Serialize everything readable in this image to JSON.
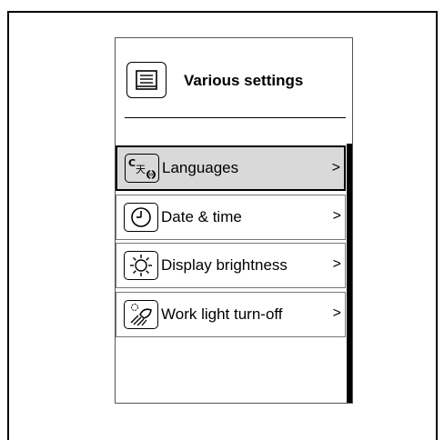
{
  "header": {
    "title": "Various settings",
    "icon": "document-icon"
  },
  "menu": {
    "items": [
      {
        "label": "Languages",
        "arrow": ">",
        "icon": "language-icon",
        "icon_glyph": "C天Φ",
        "selected": true
      },
      {
        "label": "Date & time",
        "arrow": ">",
        "icon": "clock-icon",
        "selected": false
      },
      {
        "label": "Display brightness",
        "arrow": ">",
        "icon": "brightness-icon",
        "selected": false
      },
      {
        "label": "Work light turn-off",
        "arrow": ">",
        "icon": "work-light-icon",
        "selected": false
      }
    ]
  },
  "colors": {
    "selected_bg": "#d9d9d9",
    "border": "#000000",
    "scrollbar": "#000000"
  }
}
